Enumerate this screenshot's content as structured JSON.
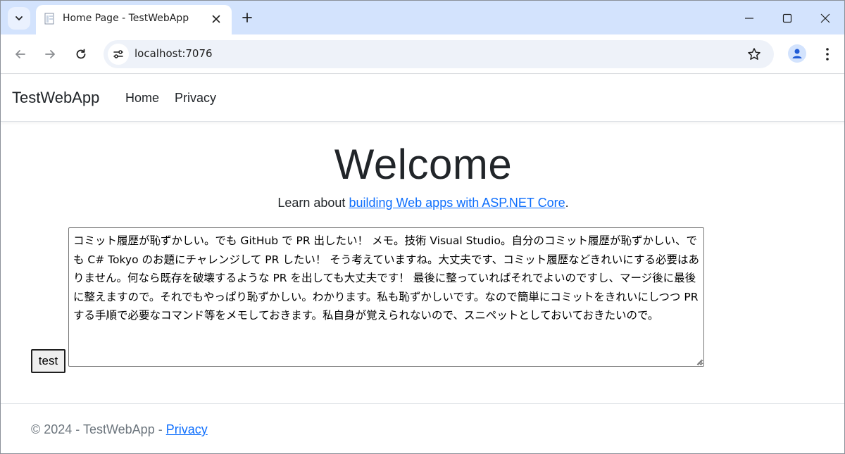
{
  "browser": {
    "tab_title": "Home Page - TestWebApp",
    "url": "localhost:7076",
    "icons": {
      "tab_search": "chevron-down-icon",
      "favicon": "page-favicon-icon",
      "tab_close": "close-icon",
      "new_tab": "plus-icon",
      "minimize": "minimize-icon",
      "maximize": "maximize-icon",
      "close_window": "close-icon",
      "back": "arrow-left-icon",
      "forward": "arrow-right-icon",
      "reload": "reload-icon",
      "site_info": "tune-icon",
      "bookmark": "star-icon",
      "profile": "person-icon",
      "menu": "kebab-menu-icon"
    }
  },
  "site": {
    "brand": "TestWebApp",
    "nav": [
      {
        "label": "Home"
      },
      {
        "label": "Privacy"
      }
    ]
  },
  "main": {
    "heading": "Welcome",
    "lead_prefix": "Learn about ",
    "lead_link": "building Web apps with ASP.NET Core",
    "lead_suffix": ".",
    "test_button": "test",
    "memo_text": "コミット履歴が恥ずかしい。でも GitHub で PR 出したい！ メモ。技術 Visual Studio。自分のコミット履歴が恥ずかしい、でも C# Tokyo のお題にチャレンジして PR したい！ そう考えていますね。大丈夫です、コミット履歴などきれいにする必要はありません。何なら既存を破壊するような PR を出しても大丈夫です！ 最後に整っていればそれでよいのですし、マージ後に最後に整えますので。それでもやっぱり恥ずかしい。わかります。私も恥ずかしいです。なので簡単にコミットをきれいにしつつ PR する手順で必要なコマンド等をメモしておきます。私自身が覚えられないので、スニペットとしておいておきたいので。"
  },
  "footer": {
    "copyright": "© 2024 - TestWebApp - ",
    "privacy_link": "Privacy"
  },
  "colors": {
    "tabstrip": "#d3e3fd",
    "link": "#0d6efd",
    "footer_text": "#6c757d"
  }
}
